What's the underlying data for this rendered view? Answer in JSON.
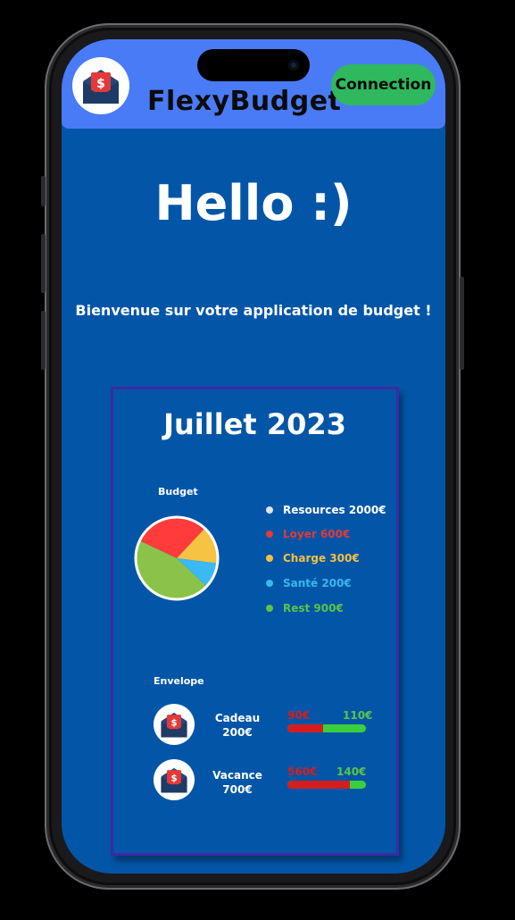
{
  "header": {
    "app_name": "FlexyBudget",
    "connection_label": "Connection",
    "logo_icon": "envelope-dollar-icon",
    "accent": "#4a7bf6"
  },
  "main": {
    "greeting": "Hello :)",
    "welcome": "Bienvenue sur votre application de budget !",
    "background": "#0356a7"
  },
  "card": {
    "month": "Juillet 2023",
    "budget_label": "Budget",
    "envelope_label": "Envelope",
    "legend": [
      {
        "label": "Resources 2000€",
        "color": "#ffffff"
      },
      {
        "label": "Loyer 600€",
        "color": "#e53935"
      },
      {
        "label": "Charge 300€",
        "color": "#f5c041"
      },
      {
        "label": "Santé 200€",
        "color": "#39b6f0"
      },
      {
        "label": "Rest 900€",
        "color": "#59c447"
      }
    ],
    "envelopes": [
      {
        "name": "Cadeau",
        "amount": "200€",
        "spent": "90€",
        "remaining": "110€",
        "spent_fraction": 0.45,
        "icon": "envelope-dollar-icon"
      },
      {
        "name": "Vacance",
        "amount": "700€",
        "spent": "560€",
        "remaining": "140€",
        "spent_fraction": 0.8,
        "icon": "envelope-dollar-icon"
      }
    ]
  },
  "chart_data": {
    "type": "pie",
    "title": "Budget",
    "categories": [
      "Loyer",
      "Charge",
      "Santé",
      "Rest"
    ],
    "values": [
      600,
      300,
      200,
      900
    ],
    "colors": [
      "#ff3b3b",
      "#f6c342",
      "#3ab9f5",
      "#8bc34a"
    ]
  }
}
